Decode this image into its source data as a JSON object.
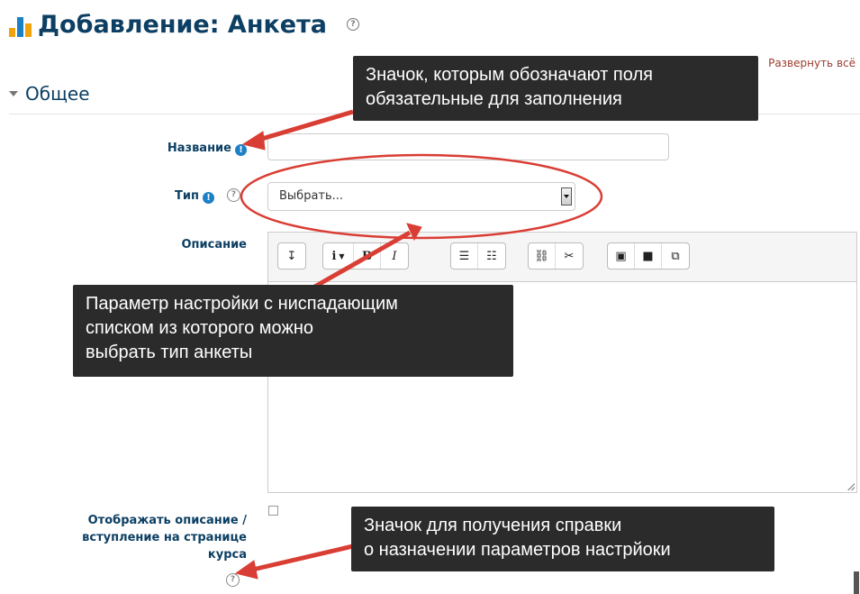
{
  "header": {
    "title": "Добавление: Анкета",
    "help_glyph": "?",
    "expand_all": "Развернуть всё"
  },
  "section": {
    "title": "Общее"
  },
  "form": {
    "name_label": "Название",
    "required_glyph": "!",
    "type_label": "Тип",
    "type_select_value": "Выбрать...",
    "description_label": "Описание",
    "show_description_label_line1": "Отображать описание /",
    "show_description_label_line2": "вступление на странице",
    "show_description_label_line3": "курса",
    "help_glyph": "?"
  },
  "editor": {
    "toolbar": {
      "collapse": "↧",
      "info": "i",
      "bold": "B",
      "italic": "I"
    }
  },
  "annotations": {
    "required_note": [
      "Значок, которым обозначают поля",
      "обязательные для заполнения"
    ],
    "dropdown_note": [
      "Параметр настройки с ниспадающим",
      "списком из которого можно",
      "выбрать тип анкеты"
    ],
    "help_note": [
      "Значок для получения справки",
      "о назначении параметров настрйоки"
    ]
  },
  "colors": {
    "heading": "#0c3f63",
    "accent": "#1c80c7",
    "annotation_bg": "#2b2b2b",
    "annotation_arrow": "#d93e34",
    "link": "#9a3c2e"
  }
}
